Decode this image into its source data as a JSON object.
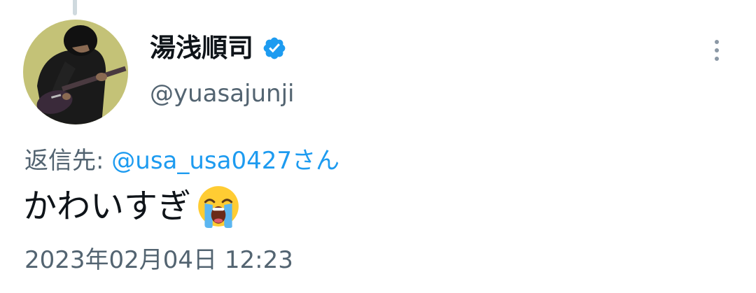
{
  "tweet": {
    "author": {
      "display_name": "湯浅順司",
      "handle": "@yuasajunji",
      "verified": true
    },
    "reply_label": "返信先: ",
    "reply_to": "@usa_usa0427さん",
    "text": "かわいすぎ",
    "emoji_icon": "loudly-crying-face-icon",
    "timestamp": "2023年02月04日 12:23"
  },
  "colors": {
    "text_primary": "#0f1419",
    "text_secondary": "#536471",
    "link": "#1d9bf0",
    "verified": "#1d9bf0",
    "thread_line": "#cfd9de"
  }
}
